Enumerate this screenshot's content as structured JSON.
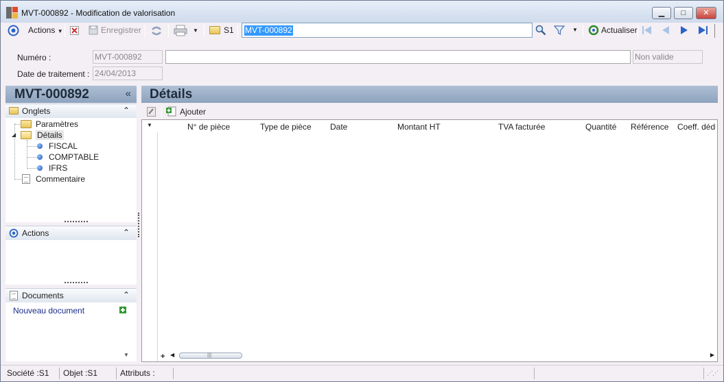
{
  "window": {
    "title": "MVT-000892 -  Modification de valorisation",
    "minimize": "▁",
    "maximize": "□",
    "close": "✕"
  },
  "toolbar": {
    "actions_label": "Actions",
    "save_label": "Enregistrer",
    "company_label": "S1",
    "search_value": "MVT-000892",
    "refresh_label": "Actualiser"
  },
  "header": {
    "numero_label": "Numéro :",
    "numero_value": "MVT-000892",
    "description_value": "",
    "status_value": "Non valide",
    "date_label": "Date de traitement :",
    "date_value": "24/04/2013"
  },
  "left_panel": {
    "title": "MVT-000892",
    "collapse": "«",
    "tabs_section": {
      "title": "Onglets",
      "items": [
        {
          "label": "Paramètres"
        },
        {
          "label": "Détails"
        },
        {
          "label": "FISCAL"
        },
        {
          "label": "COMPTABLE"
        },
        {
          "label": "IFRS"
        },
        {
          "label": "Commentaire"
        }
      ]
    },
    "actions_section": {
      "title": "Actions"
    },
    "documents_section": {
      "title": "Documents",
      "new_document": "Nouveau document"
    }
  },
  "main": {
    "title": "Détails",
    "add_label": "Ajouter",
    "columns": [
      "N° de pièce",
      "Type de pièce",
      "Date",
      "Montant HT",
      "TVA facturée",
      "Quantité",
      "Référence",
      "Coeff. déduc"
    ],
    "rows": [],
    "add_row_symbol": "+"
  },
  "status_bar": {
    "company": "Société :S1",
    "object": "Objet :S1",
    "attributes": "Attributs :"
  },
  "colors": {
    "panel_header": "#9fb2ca",
    "selection": "#3399ff",
    "accent_blue": "#1a4fb0"
  }
}
